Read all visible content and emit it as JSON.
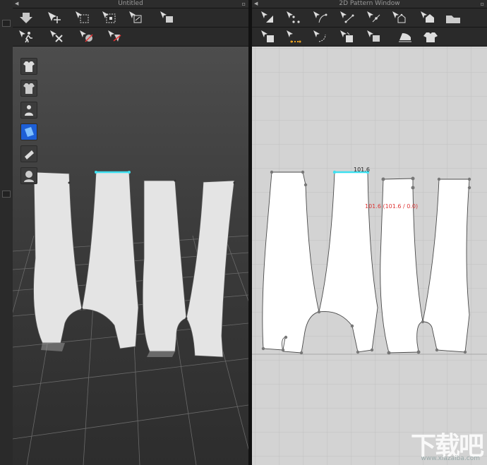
{
  "windows": {
    "left_title": "Untitled",
    "right_title": "2D Pattern Window"
  },
  "toolbar3d": {
    "row1": [
      "save-down-icon",
      "move-tool-icon",
      "select-box-icon",
      "transform-box-icon",
      "export-icon",
      "undo-icon"
    ],
    "row2": [
      "walk-avatar-icon",
      "simulate-icon",
      "pin-tool-icon",
      "fold-tool-icon"
    ]
  },
  "toolbar2d": {
    "row1": [
      "edit-pattern-icon",
      "add-point-icon",
      "curve-point-icon",
      "edit-curvature-icon",
      "segment-point-icon",
      "internal-polygon-icon",
      "rectangle-pattern-icon"
    ],
    "row2": [
      "segment-sewing-icon",
      "free-sewing-icon",
      "check-sewing-icon",
      "fold-arrangement-icon",
      "reset-icon",
      "steam-iron-icon",
      "garment-icon"
    ]
  },
  "side_tools": [
    "garment-front-icon",
    "garment-back-icon",
    "avatar-icon",
    "fabric-icon",
    "texture-icon",
    "avatar-head-icon"
  ],
  "measurement": {
    "length": "101.6",
    "detail": "101.6 (101.6 / 0.0)"
  },
  "colors": {
    "selection": "#3ee0f0",
    "measure_text": "#dd3333"
  },
  "watermark": {
    "text": "下载吧",
    "url": "www.xiazaiba.com"
  }
}
